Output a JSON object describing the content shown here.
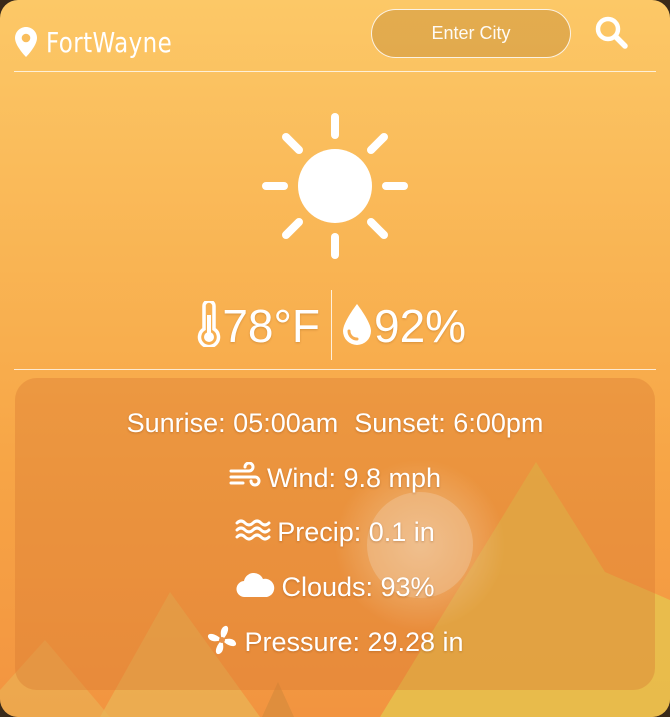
{
  "header": {
    "city": "FortWayne",
    "city_input_placeholder": "Enter City",
    "icons": {
      "location": "map-pin-icon",
      "search": "search-icon"
    }
  },
  "current": {
    "condition_icon": "sun-icon",
    "temperature": "78°F",
    "humidity": "92%",
    "icons": {
      "temperature": "thermometer-icon",
      "humidity": "droplet-icon"
    }
  },
  "details": {
    "sunrise": "Sunrise: 05:00am",
    "sunset": "Sunset: 6:00pm",
    "wind": "Wind: 9.8 mph",
    "precip": "Precip: 0.1 in",
    "clouds": "Clouds: 93%",
    "pressure": "Pressure: 29.28 in",
    "icons": {
      "wind": "wind-icon",
      "precip": "waves-icon",
      "clouds": "cloud-icon",
      "pressure": "fan-icon"
    }
  },
  "colors": {
    "background_top": "#fcc867",
    "background_bottom": "#f29440",
    "text": "#ffffff"
  }
}
